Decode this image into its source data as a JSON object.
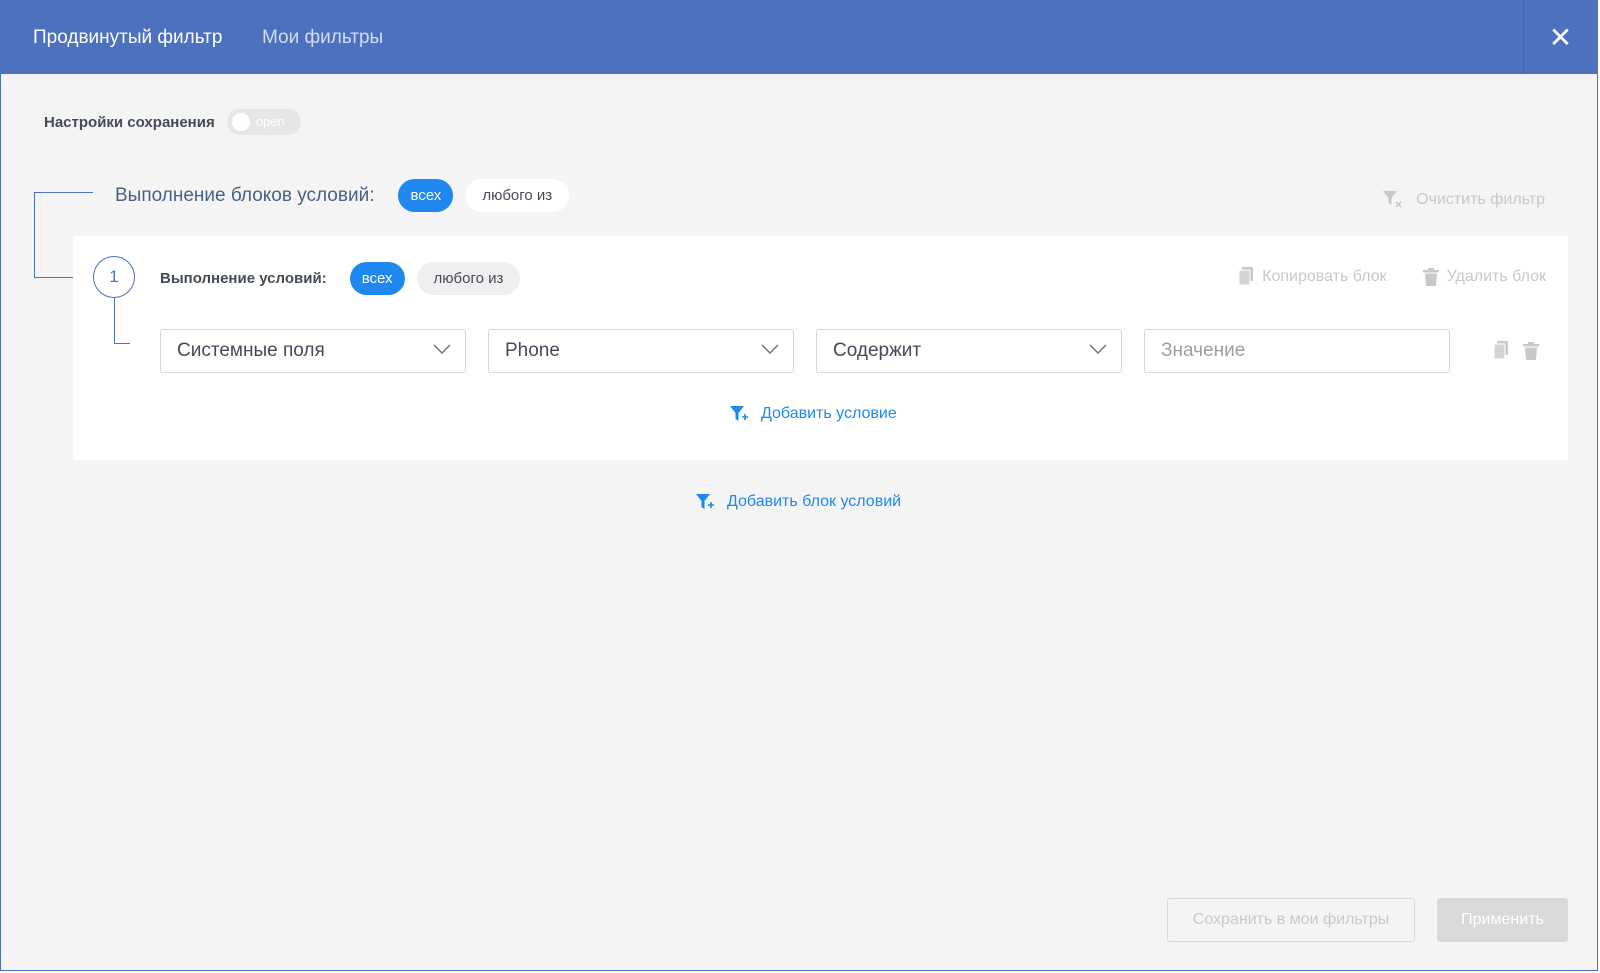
{
  "header": {
    "tabs": [
      {
        "label": "Продвинутый фильтр",
        "active": true
      },
      {
        "label": "Мои фильтры",
        "active": false
      }
    ],
    "close_icon": "close-icon",
    "close_glyph": "✕"
  },
  "save_settings": {
    "label": "Настройки сохранения",
    "toggle_text": "open",
    "toggle_on": false
  },
  "blocks_logic": {
    "label": "Выполнение блоков условий:",
    "options": [
      "всех",
      "любого из"
    ],
    "selected": "всех"
  },
  "clear_filter": {
    "label": "Очистить фильтр",
    "icon": "filter-clear-icon"
  },
  "block": {
    "number": "1",
    "conditions_label": "Выполнение условий:",
    "options": [
      "всех",
      "любого из"
    ],
    "selected": "всех",
    "copy_label": "Копировать блок",
    "delete_label": "Удалить блок",
    "condition": {
      "field_group": "Системные поля",
      "field": "Phone",
      "operator": "Содержит",
      "value_placeholder": "Значение"
    },
    "add_condition_label": "Добавить условие"
  },
  "add_block_label": "Добавить блок условий",
  "footer": {
    "save_label": "Сохранить в мои фильтры",
    "apply_label": "Применить"
  },
  "colors": {
    "header": "#4b71bf",
    "accent": "#1e88f0",
    "disabled": "#c8c8c8",
    "background": "#f4f4f4"
  }
}
